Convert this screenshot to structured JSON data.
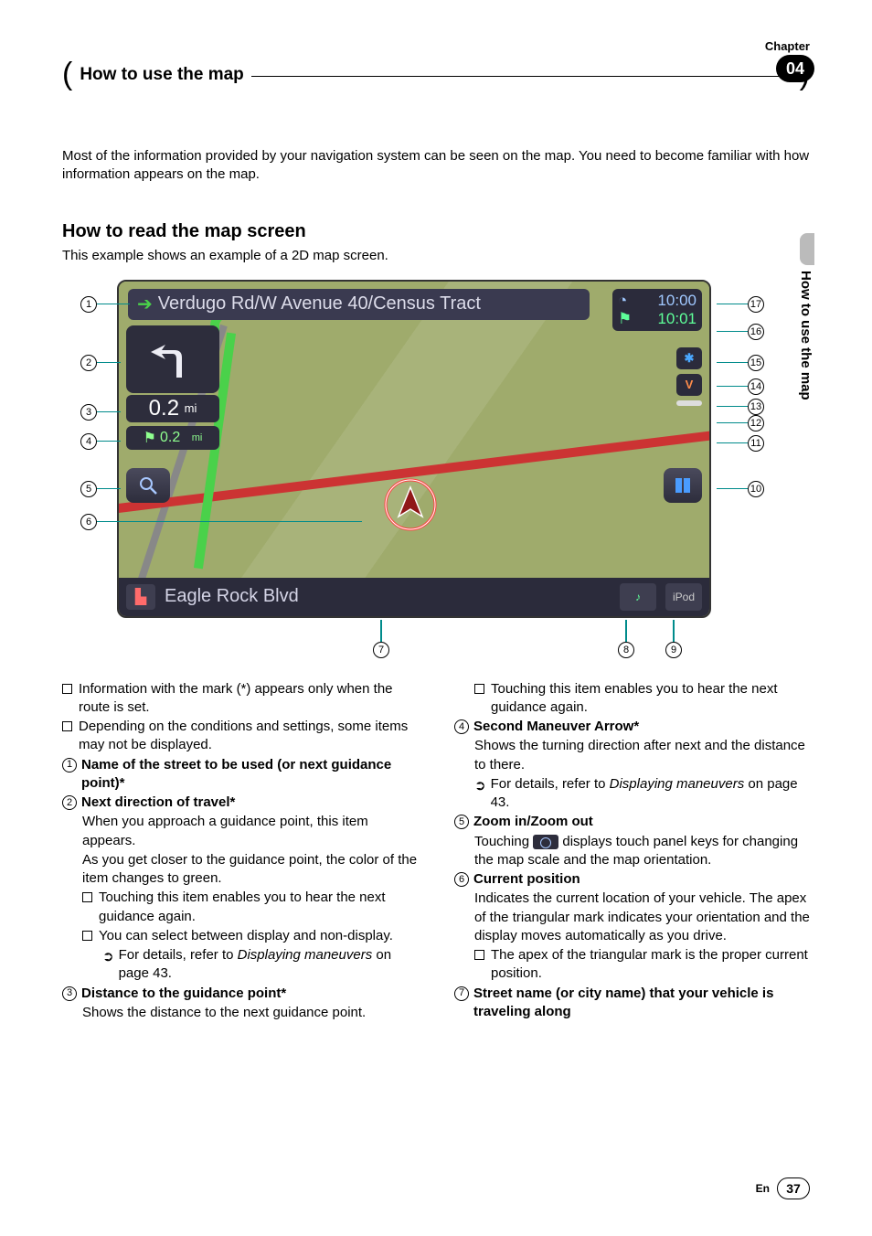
{
  "chapterLabel": "Chapter",
  "chapterNum": "04",
  "sectionTitle": "How to use the map",
  "intro": "Most of the information provided by your navigation system can be seen on the map. You need to become familiar with how information appears on the map.",
  "h2": "How to read the map screen",
  "sub": "This example shows an example of a 2D map screen.",
  "sideTab": "How to use the map",
  "map": {
    "topStreet": "Verdugo Rd/W Avenue 40/Census Tract",
    "dist1": "0.2",
    "distUnit": "mi",
    "dist2": "0.2",
    "dist2Unit": "mi",
    "time1": "10:00",
    "time2": "10:01",
    "bottomStreet": "Eagle Rock Blvd",
    "ipod": "iPod"
  },
  "callouts": {
    "c1": "1",
    "c2": "2",
    "c3": "3",
    "c4": "4",
    "c5": "5",
    "c6": "6",
    "c7": "7",
    "c8": "8",
    "c9": "9",
    "c10": "10",
    "c11": "11",
    "c12": "12",
    "c13": "13",
    "c14": "14",
    "c15": "15",
    "c16": "16",
    "c17": "17"
  },
  "colLeft": {
    "b1": "Information with the mark (*) appears only when the route is set.",
    "b2": "Depending on the conditions and settings, some items may not be displayed.",
    "t1": "Name of the street to be used (or next guidance point)*",
    "t2": "Next direction of travel*",
    "t2a": "When you approach a guidance point, this item appears.",
    "t2b": "As you get closer to the guidance point, the color of the item changes to green.",
    "t2c": "Touching this item enables you to hear the next guidance again.",
    "t2d": "You can select between display and non-display.",
    "t2e1": "For details, refer to ",
    "t2e2": "Displaying maneuvers",
    "t2e3": " on page 43.",
    "t3": "Distance to the guidance point*",
    "t3a": "Shows the distance to the next guidance point."
  },
  "colRight": {
    "r1": "Touching this item enables you to hear the next guidance again.",
    "t4": "Second Maneuver Arrow*",
    "t4a": "Shows the turning direction after next and the distance to there.",
    "t4b1": "For details, refer to ",
    "t4b2": "Displaying maneuvers",
    "t4b3": " on page 43.",
    "t5": "Zoom in/Zoom out",
    "t5a1": "Touching ",
    "t5a2": " displays touch panel keys for changing the map scale and the map orientation.",
    "t6": "Current position",
    "t6a": "Indicates the current location of your vehicle. The apex of the triangular mark indicates your orientation and the display moves automatically as you drive.",
    "t6b": "The apex of the triangular mark is the proper current position.",
    "t7": "Street name (or city name) that your vehicle is traveling along"
  },
  "footer": {
    "en": "En",
    "page": "37"
  }
}
